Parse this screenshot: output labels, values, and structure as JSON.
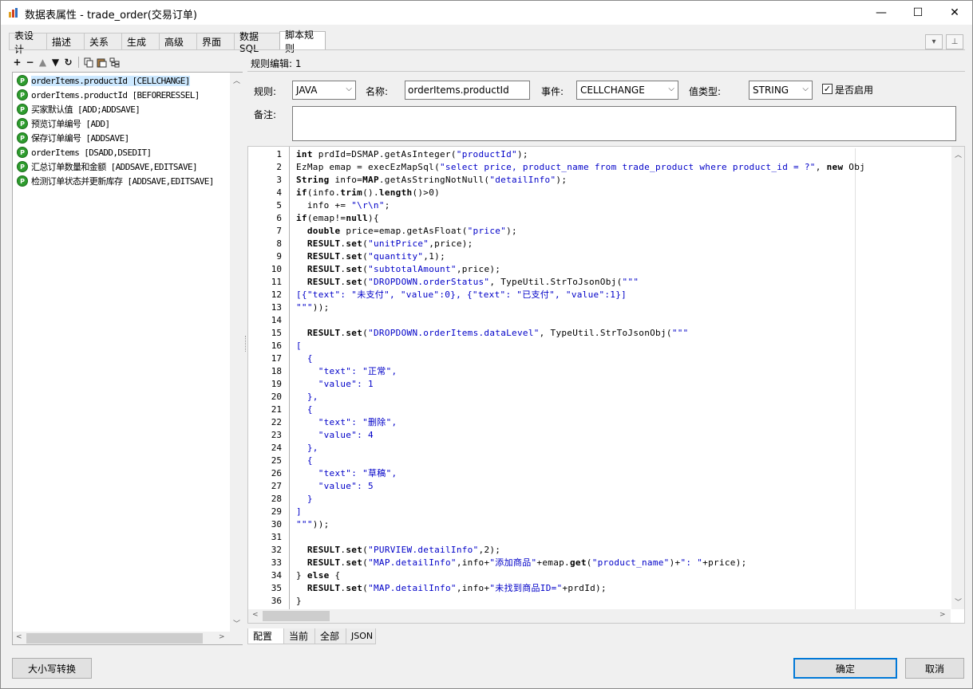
{
  "window": {
    "title": "数据表属性 - trade_order(交易订单)",
    "minimize_glyph": "—",
    "maximize_glyph": "☐",
    "close_glyph": "✕"
  },
  "tabs": [
    {
      "label": "表设计",
      "active": false
    },
    {
      "label": "描述",
      "active": false
    },
    {
      "label": "关系",
      "active": false
    },
    {
      "label": "生成",
      "active": false
    },
    {
      "label": "高级",
      "active": false
    },
    {
      "label": "界面",
      "active": false
    },
    {
      "label": "数据SQL",
      "active": false
    },
    {
      "label": "脚本规则",
      "active": true
    }
  ],
  "toolbar": {
    "add": "+",
    "remove": "−",
    "up": "🡑",
    "down": "🡓",
    "refresh": "↻",
    "copy": "⎘",
    "paste": "📋",
    "tree": "品"
  },
  "rules": [
    {
      "text": "orderItems.productId [CELLCHANGE]",
      "selected": true
    },
    {
      "text": "orderItems.productId [BEFORERESSEL]",
      "selected": false
    },
    {
      "text": "买家默认值 [ADD;ADDSAVE]",
      "selected": false
    },
    {
      "text": "预览订单编号 [ADD]",
      "selected": false
    },
    {
      "text": "保存订单编号 [ADDSAVE]",
      "selected": false
    },
    {
      "text": "orderItems [DSADD,DSEDIT]",
      "selected": false
    },
    {
      "text": "汇总订单数量和金额 [ADDSAVE,EDITSAVE]",
      "selected": false
    },
    {
      "text": "检测订单状态并更新库存 [ADDSAVE,EDITSAVE]",
      "selected": false
    }
  ],
  "editor": {
    "header": "规则编辑: 1",
    "rule_label": "规则:",
    "rule_value": "JAVA",
    "name_label": "名称:",
    "name_value": "orderItems.productId",
    "event_label": "事件:",
    "event_value": "CELLCHANGE",
    "valuetype_label": "值类型:",
    "valuetype_value": "STRING",
    "enabled_label": "是否启用",
    "enabled_mark": "✓",
    "note_label": "备注:"
  },
  "code": {
    "line_numbers": [
      "1",
      "2",
      "3",
      "4",
      "5",
      "6",
      "7",
      "8",
      "9",
      "10",
      "11",
      "12",
      "13",
      "14",
      "15",
      "16",
      "17",
      "18",
      "19",
      "20",
      "21",
      "22",
      "23",
      "24",
      "25",
      "26",
      "27",
      "28",
      "29",
      "30",
      "31",
      "32",
      "33",
      "34",
      "35",
      "36"
    ],
    "lines": [
      [
        {
          "t": "int",
          "k": "b"
        },
        {
          "t": " prdId=DSMAP.getAsInteger("
        },
        {
          "t": "\"productId\"",
          "k": "s"
        },
        {
          "t": ");"
        }
      ],
      [
        {
          "t": "EzMap emap = execEzMapSql("
        },
        {
          "t": "\"select price, product_name from trade_product where product_id = ?\"",
          "k": "s"
        },
        {
          "t": ", "
        },
        {
          "t": "new",
          "k": "b"
        },
        {
          "t": " Obj"
        }
      ],
      [
        {
          "t": "String",
          "k": "b"
        },
        {
          "t": " info="
        },
        {
          "t": "MAP",
          "k": "b"
        },
        {
          "t": ".getAsStringNotNull("
        },
        {
          "t": "\"detailInfo\"",
          "k": "s"
        },
        {
          "t": ");"
        }
      ],
      [
        {
          "t": "if",
          "k": "b"
        },
        {
          "t": "(info."
        },
        {
          "t": "trim",
          "k": "b"
        },
        {
          "t": "()."
        },
        {
          "t": "length",
          "k": "b"
        },
        {
          "t": "()>0)"
        }
      ],
      [
        {
          "t": "  info += "
        },
        {
          "t": "\"\\r\\n\"",
          "k": "s"
        },
        {
          "t": ";"
        }
      ],
      [
        {
          "t": "if",
          "k": "b"
        },
        {
          "t": "(emap!="
        },
        {
          "t": "null",
          "k": "b"
        },
        {
          "t": "){"
        }
      ],
      [
        {
          "t": "  "
        },
        {
          "t": "double",
          "k": "b"
        },
        {
          "t": " price=emap.getAsFloat("
        },
        {
          "t": "\"price\"",
          "k": "s"
        },
        {
          "t": ");"
        }
      ],
      [
        {
          "t": "  "
        },
        {
          "t": "RESULT",
          "k": "b"
        },
        {
          "t": "."
        },
        {
          "t": "set",
          "k": "b"
        },
        {
          "t": "("
        },
        {
          "t": "\"unitPrice\"",
          "k": "s"
        },
        {
          "t": ",price);"
        }
      ],
      [
        {
          "t": "  "
        },
        {
          "t": "RESULT",
          "k": "b"
        },
        {
          "t": "."
        },
        {
          "t": "set",
          "k": "b"
        },
        {
          "t": "("
        },
        {
          "t": "\"quantity\"",
          "k": "s"
        },
        {
          "t": ",1);"
        }
      ],
      [
        {
          "t": "  "
        },
        {
          "t": "RESULT",
          "k": "b"
        },
        {
          "t": "."
        },
        {
          "t": "set",
          "k": "b"
        },
        {
          "t": "("
        },
        {
          "t": "\"subtotalAmount\"",
          "k": "s"
        },
        {
          "t": ",price);"
        }
      ],
      [
        {
          "t": "  "
        },
        {
          "t": "RESULT",
          "k": "b"
        },
        {
          "t": "."
        },
        {
          "t": "set",
          "k": "b"
        },
        {
          "t": "("
        },
        {
          "t": "\"DROPDOWN.orderStatus\"",
          "k": "s"
        },
        {
          "t": ", TypeUtil.StrToJsonObj("
        },
        {
          "t": "\"\"\"",
          "k": "s"
        }
      ],
      [
        {
          "t": "[{",
          "k": "s"
        },
        {
          "t": "\"text\"",
          "k": "s"
        },
        {
          "t": ": ",
          "k": "s"
        },
        {
          "t": "\"未支付\"",
          "k": "s"
        },
        {
          "t": ", ",
          "k": "s"
        },
        {
          "t": "\"value\"",
          "k": "s"
        },
        {
          "t": ":0}, {",
          "k": "s"
        },
        {
          "t": "\"text\"",
          "k": "s"
        },
        {
          "t": ": ",
          "k": "s"
        },
        {
          "t": "\"已支付\"",
          "k": "s"
        },
        {
          "t": ", ",
          "k": "s"
        },
        {
          "t": "\"value\"",
          "k": "s"
        },
        {
          "t": ":1}]",
          "k": "s"
        }
      ],
      [
        {
          "t": "\"\"\"",
          "k": "s"
        },
        {
          "t": "));"
        }
      ],
      [
        {
          "t": ""
        }
      ],
      [
        {
          "t": "  "
        },
        {
          "t": "RESULT",
          "k": "b"
        },
        {
          "t": "."
        },
        {
          "t": "set",
          "k": "b"
        },
        {
          "t": "("
        },
        {
          "t": "\"DROPDOWN.orderItems.dataLevel\"",
          "k": "s"
        },
        {
          "t": ", TypeUtil.StrToJsonObj("
        },
        {
          "t": "\"\"\"",
          "k": "s"
        }
      ],
      [
        {
          "t": "[",
          "k": "s"
        }
      ],
      [
        {
          "t": "  {",
          "k": "s"
        }
      ],
      [
        {
          "t": "    \"text\": \"正常\",",
          "k": "s"
        }
      ],
      [
        {
          "t": "    \"value\": 1",
          "k": "s"
        }
      ],
      [
        {
          "t": "  },",
          "k": "s"
        }
      ],
      [
        {
          "t": "  {",
          "k": "s"
        }
      ],
      [
        {
          "t": "    \"text\": \"删除\",",
          "k": "s"
        }
      ],
      [
        {
          "t": "    \"value\": 4",
          "k": "s"
        }
      ],
      [
        {
          "t": "  },",
          "k": "s"
        }
      ],
      [
        {
          "t": "  {",
          "k": "s"
        }
      ],
      [
        {
          "t": "    \"text\": \"草稿\",",
          "k": "s"
        }
      ],
      [
        {
          "t": "    \"value\": 5",
          "k": "s"
        }
      ],
      [
        {
          "t": "  }",
          "k": "s"
        }
      ],
      [
        {
          "t": "]",
          "k": "s"
        }
      ],
      [
        {
          "t": "\"\"\"",
          "k": "s"
        },
        {
          "t": "));"
        }
      ],
      [
        {
          "t": ""
        }
      ],
      [
        {
          "t": "  "
        },
        {
          "t": "RESULT",
          "k": "b"
        },
        {
          "t": "."
        },
        {
          "t": "set",
          "k": "b"
        },
        {
          "t": "("
        },
        {
          "t": "\"PURVIEW.detailInfo\"",
          "k": "s"
        },
        {
          "t": ",2);"
        }
      ],
      [
        {
          "t": "  "
        },
        {
          "t": "RESULT",
          "k": "b"
        },
        {
          "t": "."
        },
        {
          "t": "set",
          "k": "b"
        },
        {
          "t": "("
        },
        {
          "t": "\"MAP.detailInfo\"",
          "k": "s"
        },
        {
          "t": ",info+"
        },
        {
          "t": "\"添加商品\"",
          "k": "s"
        },
        {
          "t": "+emap."
        },
        {
          "t": "get",
          "k": "b"
        },
        {
          "t": "("
        },
        {
          "t": "\"product_name\"",
          "k": "s"
        },
        {
          "t": ")+"
        },
        {
          "t": "\": \"",
          "k": "s"
        },
        {
          "t": "+price);"
        }
      ],
      [
        {
          "t": "} "
        },
        {
          "t": "else",
          "k": "b"
        },
        {
          "t": " {"
        }
      ],
      [
        {
          "t": "  "
        },
        {
          "t": "RESULT",
          "k": "b"
        },
        {
          "t": "."
        },
        {
          "t": "set",
          "k": "b"
        },
        {
          "t": "("
        },
        {
          "t": "\"MAP.detailInfo\"",
          "k": "s"
        },
        {
          "t": ",info+"
        },
        {
          "t": "\"未找到商品ID=\"",
          "k": "s"
        },
        {
          "t": "+prdId);"
        }
      ],
      [
        {
          "t": "}"
        }
      ]
    ]
  },
  "bottom_tabs": [
    {
      "label": "配置",
      "active": true
    },
    {
      "label": "当前",
      "active": false
    },
    {
      "label": "全部",
      "active": false
    },
    {
      "label": "JSON",
      "active": false
    }
  ],
  "buttons": {
    "case_convert": "大小写转换",
    "ok": "确定",
    "cancel": "取消"
  }
}
